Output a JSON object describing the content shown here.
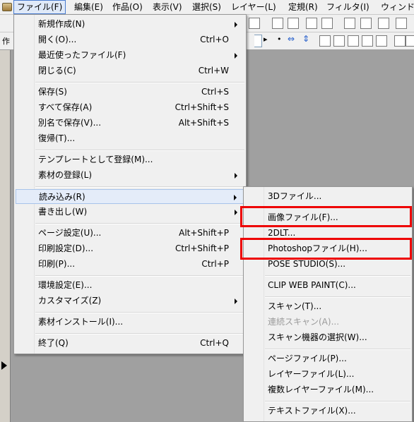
{
  "menubar": {
    "items": [
      "ファイル(F)",
      "編集(E)",
      "作品(O)",
      "表示(V)",
      "選択(S)",
      "レイヤー(L)",
      "定規(R)",
      "フィルタ(I)",
      "ウィンド"
    ]
  },
  "toolbar2": {
    "partial_text": "作"
  },
  "file_menu": {
    "items": [
      {
        "label": "新規作成(N)",
        "shortcut": "",
        "submenu": true
      },
      {
        "label": "開く(O)...",
        "shortcut": "Ctrl+O",
        "submenu": false
      },
      {
        "label": "最近使ったファイル(F)",
        "shortcut": "",
        "submenu": true
      },
      {
        "label": "閉じる(C)",
        "shortcut": "Ctrl+W",
        "submenu": false
      },
      {
        "label": "保存(S)",
        "shortcut": "Ctrl+S",
        "submenu": false
      },
      {
        "label": "すべて保存(A)",
        "shortcut": "Ctrl+Shift+S",
        "submenu": false
      },
      {
        "label": "別名で保存(V)...",
        "shortcut": "Alt+Shift+S",
        "submenu": false
      },
      {
        "label": "復帰(T)...",
        "shortcut": "",
        "submenu": false
      },
      {
        "label": "テンプレートとして登録(M)...",
        "shortcut": "",
        "submenu": false
      },
      {
        "label": "素材の登録(L)",
        "shortcut": "",
        "submenu": true
      },
      {
        "label": "読み込み(R)",
        "shortcut": "",
        "submenu": true
      },
      {
        "label": "書き出し(W)",
        "shortcut": "",
        "submenu": true
      },
      {
        "label": "ページ設定(U)...",
        "shortcut": "Alt+Shift+P",
        "submenu": false
      },
      {
        "label": "印刷設定(D)...",
        "shortcut": "Ctrl+Shift+P",
        "submenu": false
      },
      {
        "label": "印刷(P)...",
        "shortcut": "Ctrl+P",
        "submenu": false
      },
      {
        "label": "環境設定(E)...",
        "shortcut": "",
        "submenu": false
      },
      {
        "label": "カスタマイズ(Z)",
        "shortcut": "",
        "submenu": true
      },
      {
        "label": "素材インストール(I)...",
        "shortcut": "",
        "submenu": false
      },
      {
        "label": "終了(Q)",
        "shortcut": "Ctrl+Q",
        "submenu": false
      }
    ]
  },
  "import_menu": {
    "items": [
      {
        "label": "3Dファイル...",
        "disabled": false
      },
      {
        "label": "画像ファイル(F)...",
        "disabled": false
      },
      {
        "label": "2DLT...",
        "disabled": false
      },
      {
        "label": "Photoshopファイル(H)...",
        "disabled": false
      },
      {
        "label": "POSE STUDIO(S)...",
        "disabled": false
      },
      {
        "label": "CLIP WEB PAINT(C)...",
        "disabled": false
      },
      {
        "label": "スキャン(T)...",
        "disabled": false
      },
      {
        "label": "連続スキャン(A)...",
        "disabled": true
      },
      {
        "label": "スキャン機器の選択(W)...",
        "disabled": false
      },
      {
        "label": "ページファイル(P)...",
        "disabled": false
      },
      {
        "label": "レイヤーファイル(L)...",
        "disabled": false
      },
      {
        "label": "複数レイヤーファイル(M)...",
        "disabled": false
      },
      {
        "label": "テキストファイル(X)...",
        "disabled": false
      }
    ]
  },
  "highlight_color": "#ee0000"
}
